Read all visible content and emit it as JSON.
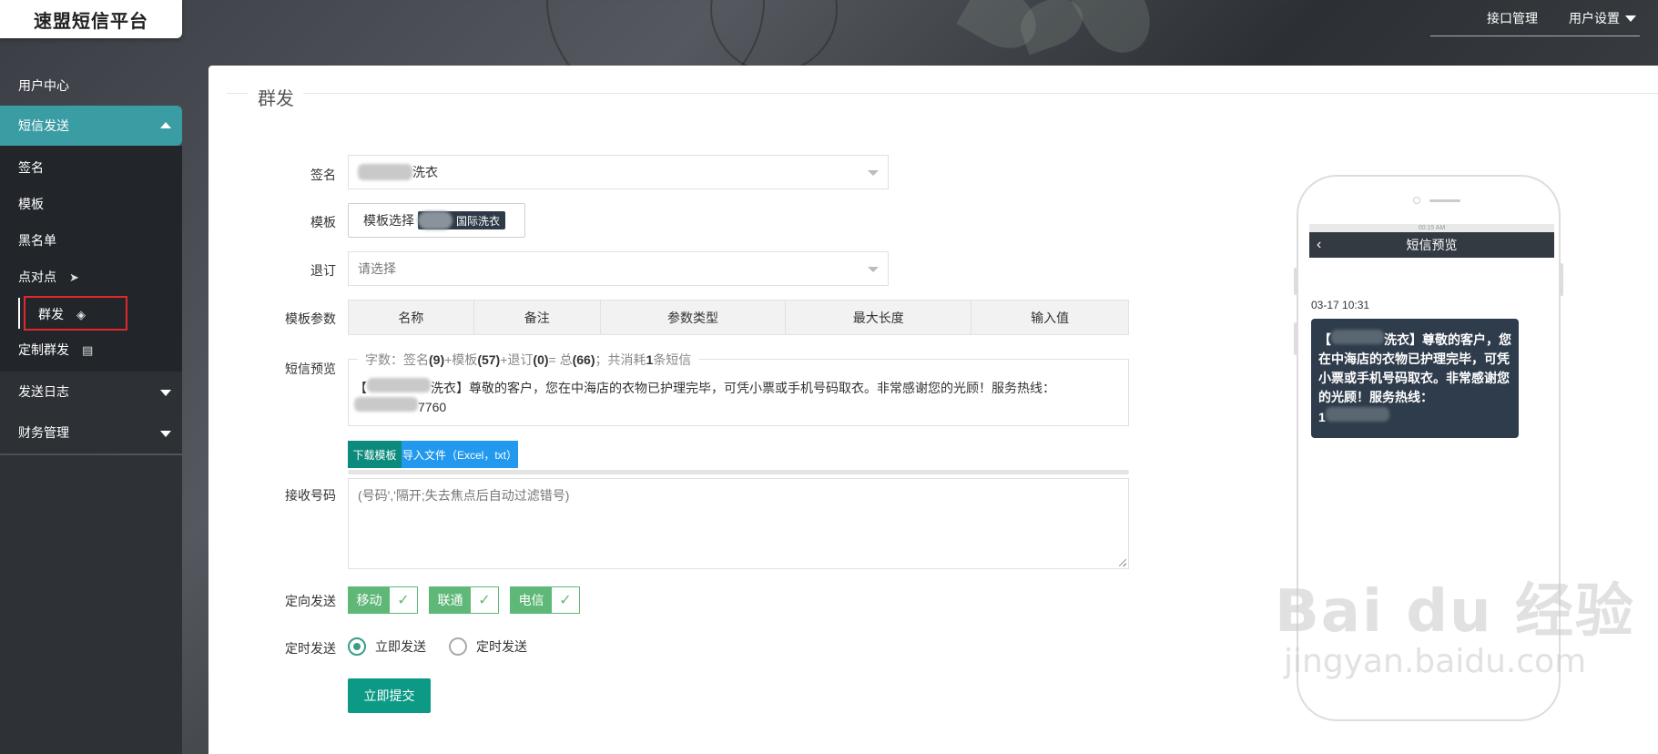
{
  "brand": "速盟短信平台",
  "top_nav": {
    "api": "接口管理",
    "user": "用户设置"
  },
  "sidebar": {
    "user_center": "用户中心",
    "sms_send": "短信发送",
    "sub_items": {
      "sign": "签名",
      "template": "模板",
      "blacklist": "黑名单",
      "p2p": "点对点",
      "mass": "群发",
      "custom_mass": "定制群发"
    },
    "send_log": "发送日志",
    "finance": "财务管理"
  },
  "main": {
    "title": "群发",
    "labels": {
      "sign": "签名",
      "template": "模板",
      "unsubscribe": "退订",
      "params": "模板参数",
      "preview": "短信预览",
      "receivers": "接收号码",
      "carrier": "定向发送",
      "schedule": "定时发送"
    },
    "sign_value": "洗衣",
    "template_button": "模板选择",
    "template_tag": "国际洗衣",
    "unsubscribe_placeholder": "请选择",
    "param_columns": [
      "名称",
      "备注",
      "参数类型",
      "最大长度",
      "输入值"
    ],
    "count": {
      "prefix": "字数：签名",
      "sign": "(9)",
      "plus1": "+模板",
      "tpl": "(57)",
      "plus2": "+退订",
      "unsub": "(0)",
      "eq": "= 总",
      "total": "(66)",
      "semi": "；共消耗",
      "n": "1",
      "unit": "条短信"
    },
    "preview_lead": "【",
    "preview_brand": "洗衣",
    "preview_body": "】尊敬的客户，您在中海店的衣物已护理完毕，可凭小票或手机号码取衣。非常感谢您的光顾！服务热线：",
    "preview_phone_tail": "7760",
    "download_template": "下载模板",
    "import_file": "导入文件（Excel，txt）",
    "receivers_placeholder": "(号码','隔开;失去焦点后自动过滤错号)",
    "carriers": [
      "移动",
      "联通",
      "电信"
    ],
    "schedule_now": "立即发送",
    "schedule_later": "定时发送",
    "submit": "立即提交"
  },
  "phone": {
    "status_time": "00:15 AM",
    "title": "短信预览",
    "time": "03-17 10:31",
    "msg_lead": "【",
    "msg_brand": "洗衣",
    "msg_body": "】尊敬的客户，您在中海店的衣物已护理完毕，可凭小票或手机号码取衣。非常感谢您的光顾！服务热线：",
    "msg_phone_head": "1"
  },
  "watermark": {
    "big": "Bai du 经验",
    "small": "jingyan.baidu.com"
  }
}
